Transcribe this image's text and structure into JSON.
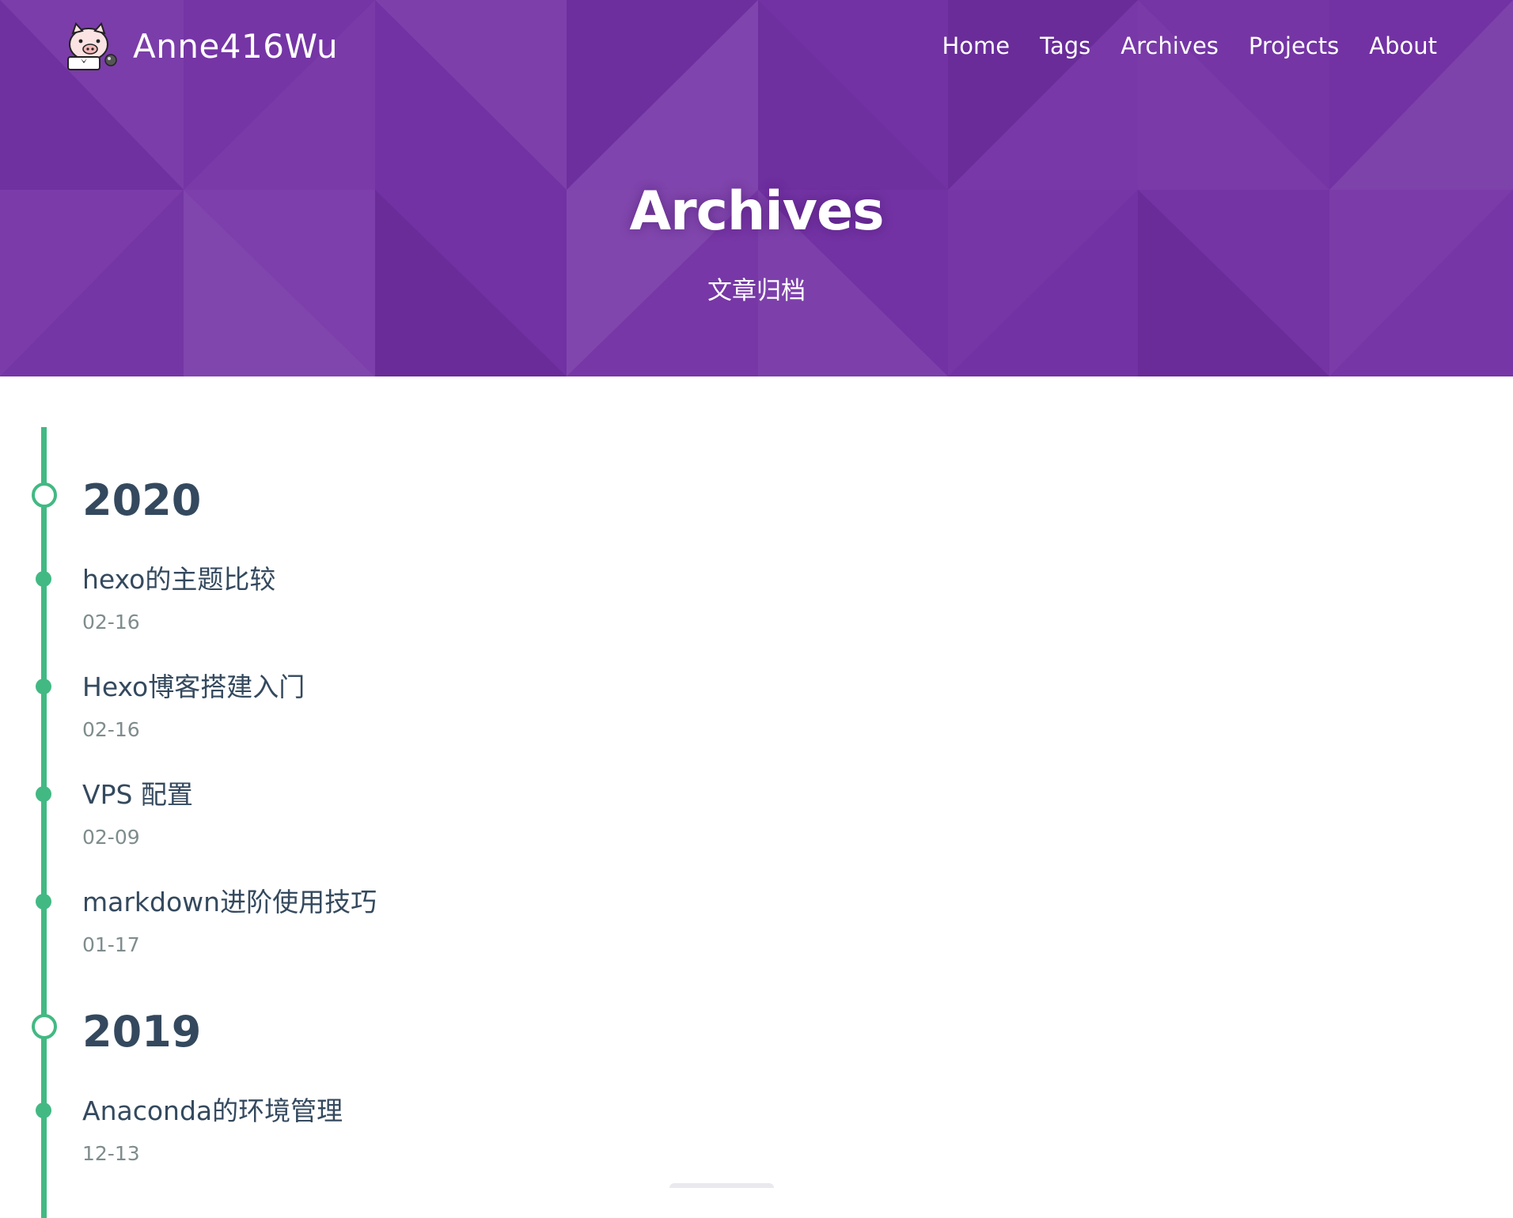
{
  "site": {
    "name": "Anne416Wu",
    "logo_icon": "pig-avatar-icon"
  },
  "nav": {
    "items": [
      {
        "label": "Home"
      },
      {
        "label": "Tags"
      },
      {
        "label": "Archives"
      },
      {
        "label": "Projects"
      },
      {
        "label": "About"
      }
    ]
  },
  "hero": {
    "title": "Archives",
    "subtitle": "文章归档"
  },
  "archives": [
    {
      "year": "2020",
      "posts": [
        {
          "title": "hexo的主题比较",
          "date": "02-16"
        },
        {
          "title": "Hexo博客搭建入门",
          "date": "02-16"
        },
        {
          "title": "VPS 配置",
          "date": "02-09"
        },
        {
          "title": "markdown进阶使用技巧",
          "date": "01-17"
        }
      ]
    },
    {
      "year": "2019",
      "posts": [
        {
          "title": "Anaconda的环境管理",
          "date": "12-13"
        }
      ]
    }
  ],
  "colors": {
    "hero_purple": "#7232a3",
    "timeline_green": "#42b983",
    "text_dark": "#34495e",
    "text_muted": "#7f8c8d"
  }
}
